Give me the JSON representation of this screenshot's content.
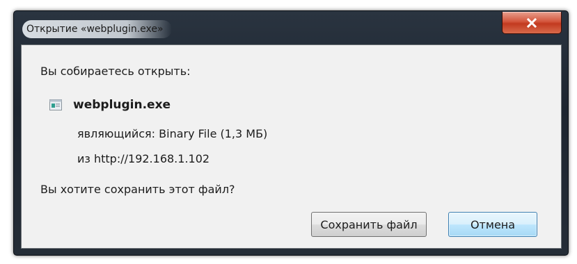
{
  "dialog": {
    "title": "Открытие «webplugin.exe»",
    "close_icon": "close-icon",
    "open_prompt": "Вы собираетесь открыть:",
    "file": {
      "icon": "application-file-icon",
      "name": "webplugin.exe",
      "type_line": "являющийся:  Binary File (1,3 МБ)",
      "source_line": "из  http://192.168.1.102"
    },
    "save_prompt": "Вы хотите сохранить этот файл?",
    "buttons": {
      "save_label": "Сохранить файл",
      "cancel_label": "Отмена"
    }
  },
  "colors": {
    "frame": "#1d2530",
    "client_area": "#f1f1f1",
    "close_button": "#c23a20",
    "default_button_border": "#3c7fb1"
  }
}
